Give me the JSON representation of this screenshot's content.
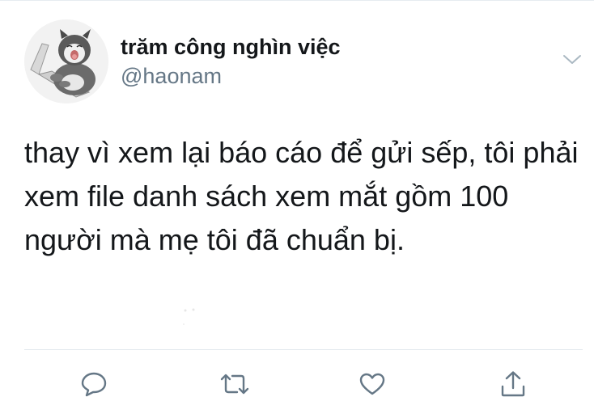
{
  "tweet": {
    "display_name": "trăm công nghìn việc",
    "handle": "@haonam",
    "text": "thay vì xem lại báo cáo để gửi sếp, tôi phải xem file danh sách xem mắt gồm 100 người mà mẹ tôi đã chuẩn bị."
  },
  "icons": {
    "menu": "chevron-down-icon",
    "reply": "speech-bubble-icon",
    "retweet": "retweet-icon",
    "like": "heart-icon",
    "share": "share-upload-icon"
  },
  "colors": {
    "text": "#14171a",
    "secondary_text": "#657786",
    "icon": "#657786",
    "divider": "#e1e8ed"
  }
}
